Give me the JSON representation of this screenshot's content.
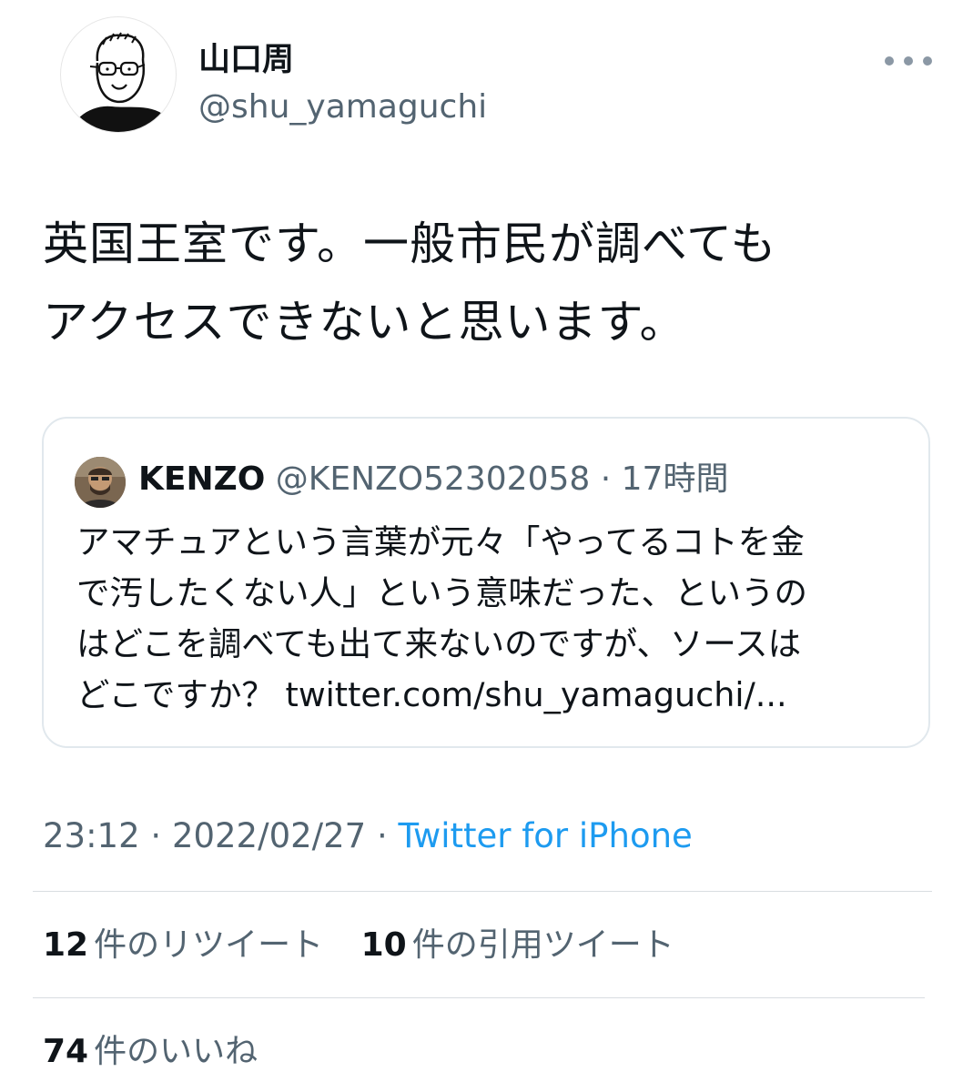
{
  "author": {
    "display_name": "山口周",
    "handle": "@shu_yamaguchi"
  },
  "tweet": {
    "text_line1": "英国王室です。一般市民が調べても",
    "text_line2": "アクセスできないと思います。"
  },
  "quoted_tweet": {
    "name": "KENZO",
    "handle": "@KENZO52302058",
    "separator": " · ",
    "time": "17時間",
    "text_lines": [
      "アマチュアという言葉が元々「やってるコトを金",
      "で汚したくない人」という意味だった、というの",
      "はどこを調べても出て来ないのですが、ソースは",
      "どこですか？ twitter.com/shu_yamaguchi/..."
    ]
  },
  "meta": {
    "time": "23:12",
    "separator1": " · ",
    "date": "2022/02/27",
    "separator2": " · ",
    "source": "Twitter for iPhone"
  },
  "stats": {
    "retweets_count": "12",
    "retweets_label": "件のリツイート",
    "quotes_count": "10",
    "quotes_label": "件の引用ツイート",
    "likes_count": "74",
    "likes_label": "件のいいね"
  },
  "colors": {
    "text_primary": "#0f1419",
    "text_secondary": "#536471",
    "link": "#1d9bf0",
    "border": "#e1e8ed"
  },
  "icons": {
    "more": "more-horizontal-icon"
  }
}
